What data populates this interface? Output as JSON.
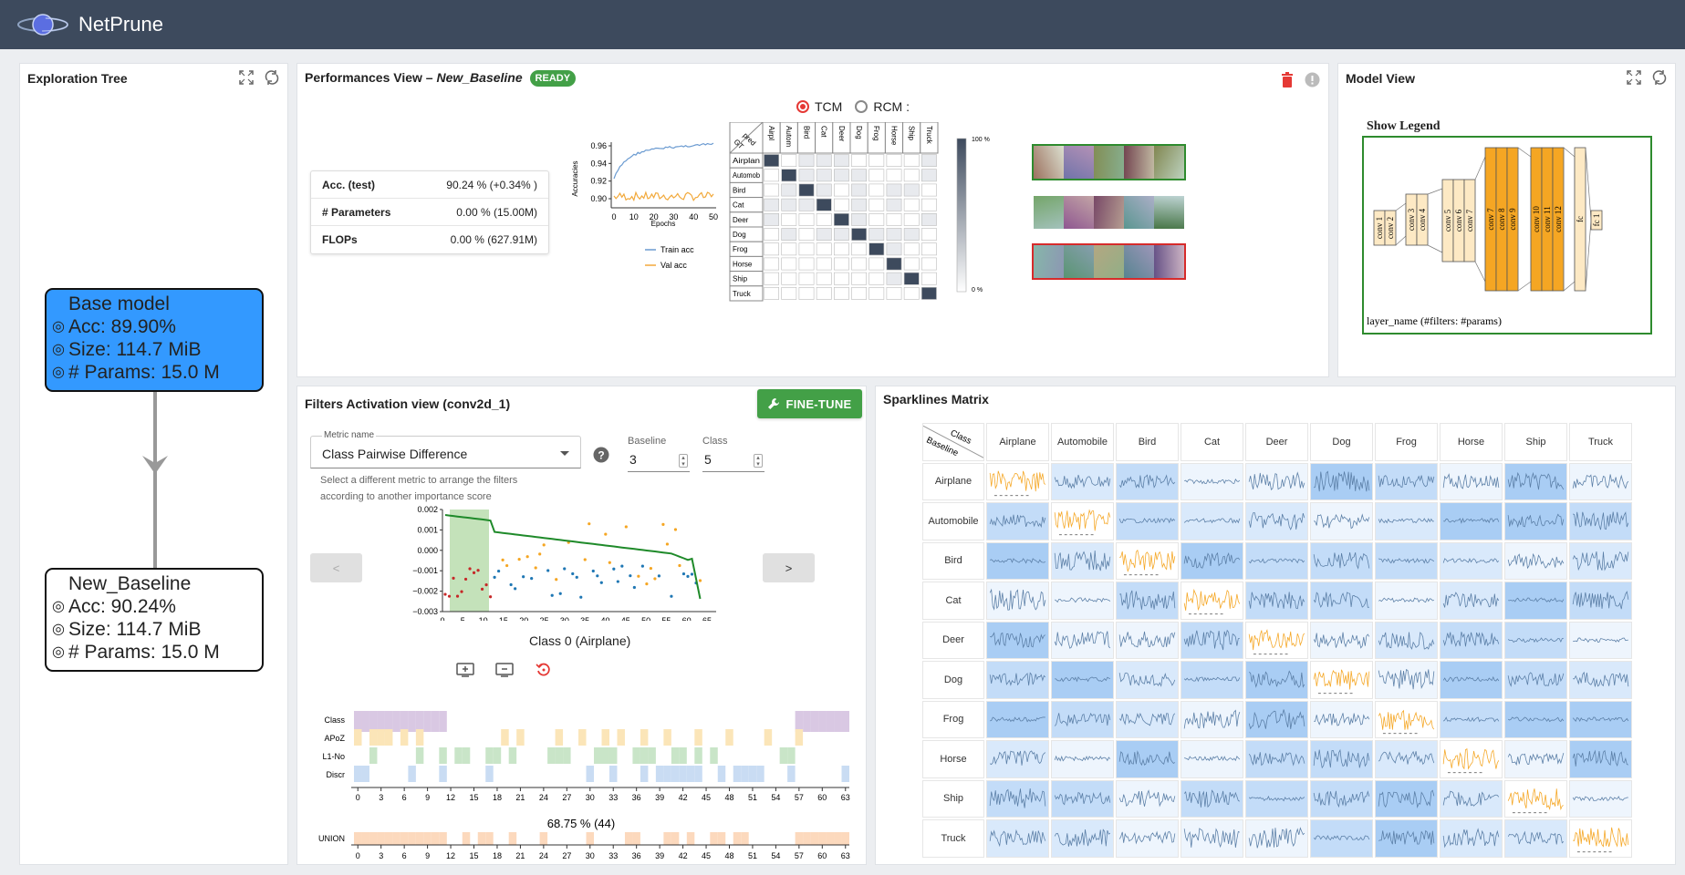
{
  "app": {
    "title": "NetPrune"
  },
  "exploration_tree": {
    "title": "Exploration Tree",
    "nodes": [
      {
        "title": "Base model",
        "acc": "Acc: 89.90%",
        "size": "Size: 114.7 MiB",
        "params": "# Params: 15.0 M"
      },
      {
        "title": "New_Baseline",
        "acc": "Acc: 90.24%",
        "size": "Size: 114.7 MiB",
        "params": "# Params: 15.0 M"
      }
    ]
  },
  "performances": {
    "title_prefix": "Performances View – ",
    "title_model": "New_Baseline",
    "badge": "READY",
    "stats": [
      {
        "label": "Acc. (test)",
        "value": "90.24 % (+0.34% )"
      },
      {
        "label": "# Parameters",
        "value": "0.00 % (15.00M)"
      },
      {
        "label": "FLOPs",
        "value": "0.00 % (627.91M)"
      }
    ],
    "acc_chart": {
      "ylabel": "Accuracies",
      "xlabel": "Epochs",
      "yticks": [
        "0.96",
        "0.94",
        "0.92",
        "0.90"
      ],
      "xticks": [
        "0",
        "10",
        "20",
        "30",
        "40",
        "50"
      ],
      "legend": [
        "Train acc",
        "Val acc"
      ],
      "train_color": "#6b9bd1",
      "val_color": "#f2a93b"
    },
    "radio_tcm": "TCM",
    "radio_rcm": "RCM :",
    "confusion": {
      "header_corner_top": "pred",
      "header_corner_bottom": "GT",
      "cols": [
        "Airpl",
        "Autom",
        "Bird",
        "Cat",
        "Deer",
        "Dog",
        "Frog",
        "Horse",
        "Ship",
        "Truck"
      ],
      "rows": [
        "Airplan",
        "Automob",
        "Bird",
        "Cat",
        "Deer",
        "Dog",
        "Frog",
        "Horse",
        "Ship",
        "Truck"
      ],
      "scale_top": "100 %",
      "scale_bottom": "0 %"
    }
  },
  "model_view": {
    "title": "Model View",
    "legend_title": "Show Legend",
    "footer": "layer_name (#filters: #params)",
    "layers": [
      "conv 1",
      "conv 2",
      "conv 3",
      "conv 4",
      "conv 5",
      "conv 6",
      "conv 7",
      "conv 8",
      "conv 9",
      "conv 10",
      "conv 11",
      "conv 12",
      "fc",
      "fc 1"
    ]
  },
  "filters": {
    "title": "Filters Activation view (conv2d_1)",
    "finetune_label": "FINE-TUNE",
    "metric_label": "Metric name",
    "metric_value": "Class Pairwise Difference",
    "help_text": "Select a different metric to arrange the filters according to another importance score",
    "baseline_label": "Baseline",
    "baseline_value": "3",
    "class_label": "Class",
    "class_value": "5",
    "prev_label": "<",
    "next_label": ">",
    "plot_xlabel": "Class 0 (Airplane)",
    "plot_yticks": [
      "0.002",
      "0.001",
      "0.000",
      "−0.001",
      "−0.002",
      "−0.003"
    ],
    "plot_xticks": [
      "0",
      "5",
      "10",
      "15",
      "20",
      "25",
      "30",
      "35",
      "40",
      "45",
      "50",
      "55",
      "60",
      "65"
    ],
    "bar_rows": [
      "Class",
      "APoZ",
      "L1-No",
      "Discr"
    ],
    "bar_xticks": [
      "0",
      "3",
      "6",
      "9",
      "12",
      "15",
      "18",
      "21",
      "24",
      "27",
      "30",
      "33",
      "36",
      "39",
      "42",
      "45",
      "48",
      "51",
      "54",
      "57",
      "60",
      "63"
    ],
    "union_pct": "68.75 % (44)",
    "union_label": "UNION"
  },
  "sparklines": {
    "title": "Sparklines Matrix",
    "corner_top": "Class",
    "corner_bottom": "Baseline",
    "classes": [
      "Airplane",
      "Automobile",
      "Bird",
      "Cat",
      "Deer",
      "Dog",
      "Frog",
      "Horse",
      "Ship",
      "Truck"
    ]
  }
}
